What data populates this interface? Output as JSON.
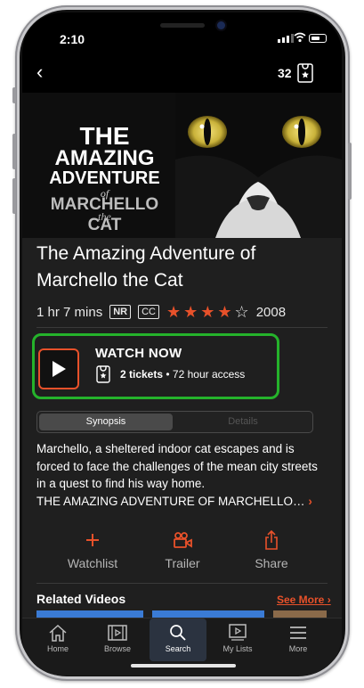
{
  "status": {
    "time": "2:10"
  },
  "nav": {
    "tickets_count": "32"
  },
  "poster": {
    "line1": "THE",
    "line2": "AMAZING",
    "line3": "ADVENTURE",
    "line4": "of",
    "line5": "MARCHELLO",
    "line6": "the",
    "line7": "CAT"
  },
  "movie": {
    "title": "The Amazing Adventure of Marchello the Cat",
    "duration": "1 hr 7 mins",
    "rating_badge": "NR",
    "cc_badge": "CC",
    "stars": 4,
    "stars_max": 5,
    "year": "2008"
  },
  "watch": {
    "label": "WATCH NOW",
    "tickets": "2 tickets",
    "access": "• 72 hour access"
  },
  "tabs_segment": {
    "synopsis": "Synopsis",
    "details": "Details"
  },
  "synopsis": {
    "text": "Marchello, a sheltered indoor cat escapes and is forced to face the challenges of the mean city streets in a quest to find his way home.",
    "more": "THE AMAZING ADVENTURE OF MARCHELLO…"
  },
  "actions": {
    "watchlist": "Watchlist",
    "trailer": "Trailer",
    "share": "Share"
  },
  "related": {
    "title": "Related Videos",
    "see_more": "See More"
  },
  "tabbar": {
    "home": "Home",
    "browse": "Browse",
    "search": "Search",
    "mylists": "My Lists",
    "more": "More"
  },
  "colors": {
    "accent": "#e8512a",
    "highlight": "#25b32b",
    "background": "#1f1f1f"
  }
}
